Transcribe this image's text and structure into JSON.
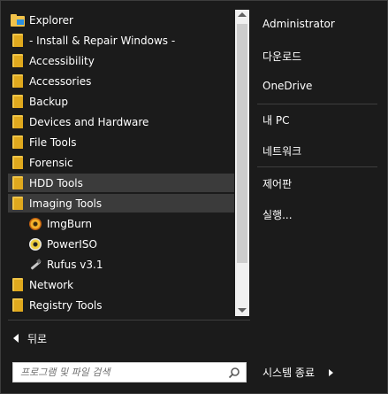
{
  "program_list": {
    "items": [
      {
        "label": "Explorer"
      },
      {
        "label": "- Install & Repair Windows -"
      },
      {
        "label": "Accessibility"
      },
      {
        "label": "Accessories"
      },
      {
        "label": "Backup"
      },
      {
        "label": "Devices and Hardware"
      },
      {
        "label": "File Tools"
      },
      {
        "label": "Forensic"
      },
      {
        "label": "HDD Tools"
      },
      {
        "label": "Imaging Tools"
      },
      {
        "label": "ImgBurn"
      },
      {
        "label": "PowerISO"
      },
      {
        "label": "Rufus v3.1"
      },
      {
        "label": "Network"
      },
      {
        "label": "Registry Tools"
      }
    ]
  },
  "back": {
    "label": "뒤로"
  },
  "search": {
    "placeholder": "프로그램 및 파일 검색"
  },
  "right_panel": {
    "items": [
      {
        "label": "Administrator"
      },
      {
        "label": "다운로드"
      },
      {
        "label": "OneDrive"
      },
      {
        "label": "내 PC"
      },
      {
        "label": "네트워크"
      },
      {
        "label": "제어판"
      },
      {
        "label": "실행..."
      }
    ]
  },
  "shutdown": {
    "label": "시스템 종료"
  },
  "colors": {
    "background": "#1b1b1b",
    "highlight": "#3b3b3b",
    "folder": "#f0c447"
  }
}
